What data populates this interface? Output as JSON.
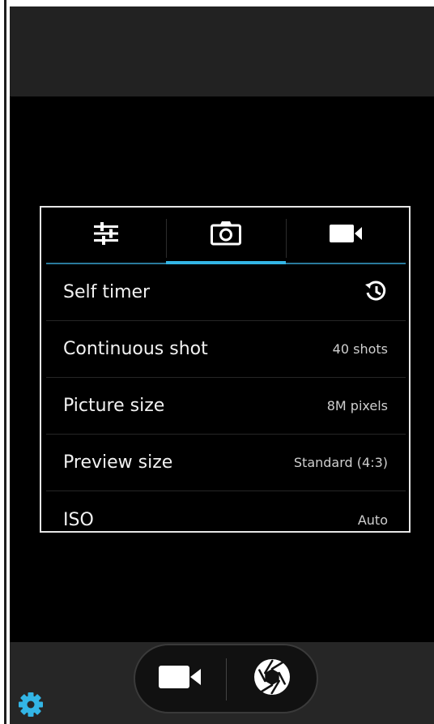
{
  "camera_settings": {
    "tabs": [
      {
        "name": "general",
        "icon": "sliders-icon",
        "active": false
      },
      {
        "name": "photo",
        "icon": "camera-icon",
        "active": true
      },
      {
        "name": "video",
        "icon": "video-camera-icon",
        "active": false
      }
    ],
    "rows": [
      {
        "label": "Self timer",
        "value": "",
        "value_icon": "timer-icon"
      },
      {
        "label": "Continuous shot",
        "value": "40 shots"
      },
      {
        "label": "Picture size",
        "value": "8M pixels"
      },
      {
        "label": "Preview size",
        "value": "Standard (4:3)"
      },
      {
        "label": "ISO",
        "value": "Auto"
      }
    ]
  },
  "controls": {
    "video_icon": "video-camera-icon",
    "shutter_icon": "shutter-aperture-icon"
  },
  "settings_icon": "gear-icon",
  "colors": {
    "accent": "#33b5e5",
    "background": "#000000",
    "top_bar": "#222222",
    "bottom_bar": "#262626",
    "panel_border": "#e6e6e6",
    "text_primary": "#f2f2f2",
    "text_secondary": "#cfcfcf"
  }
}
